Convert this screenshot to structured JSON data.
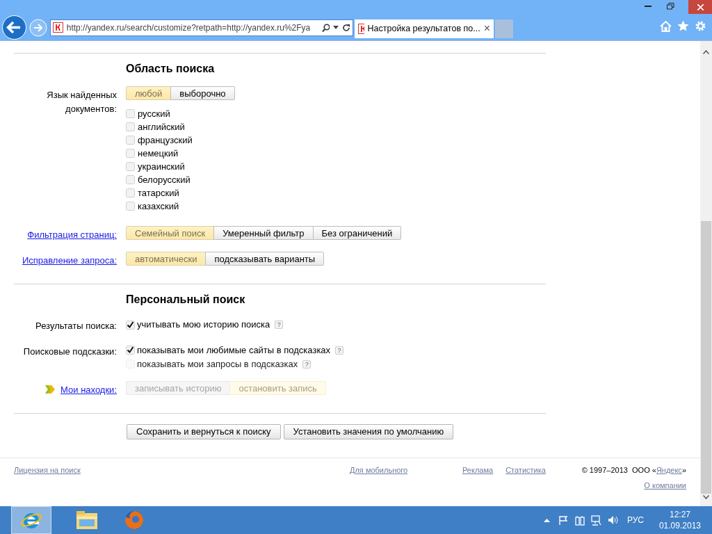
{
  "browser": {
    "url": "http://yandex.ru/search/customize?retpath=http://yandex.ru%2Fya",
    "tab_title": "Настройка результатов по...",
    "tab_close": "×"
  },
  "sections": [
    {
      "title": "Область поиска",
      "rows": [
        {
          "kind": "segmented",
          "label": "Язык найденных документов:",
          "label_link": false,
          "disabled": false,
          "has_icon": false,
          "options": [
            {
              "label": "любой",
              "selected": true
            },
            {
              "label": "выборочно",
              "selected": false
            }
          ],
          "checkboxes": [
            {
              "label": "русский",
              "checked": false
            },
            {
              "label": "английский",
              "checked": false
            },
            {
              "label": "французский",
              "checked": false
            },
            {
              "label": "немецкий",
              "checked": false
            },
            {
              "label": "украинский",
              "checked": false
            },
            {
              "label": "белорусский",
              "checked": false
            },
            {
              "label": "татарский",
              "checked": false
            },
            {
              "label": "казахский",
              "checked": false
            }
          ]
        },
        {
          "kind": "segmented",
          "label": "Фильтрация страниц:",
          "label_link": true,
          "disabled": false,
          "has_icon": false,
          "options": [
            {
              "label": "Семейный поиск",
              "selected": true
            },
            {
              "label": "Умеренный фильтр",
              "selected": false
            },
            {
              "label": "Без ограничений",
              "selected": false
            }
          ]
        },
        {
          "kind": "segmented",
          "label": "Исправление запроса:",
          "label_link": true,
          "disabled": false,
          "has_icon": false,
          "options": [
            {
              "label": "автоматически",
              "selected": true
            },
            {
              "label": "подсказывать варианты",
              "selected": false
            }
          ]
        }
      ]
    },
    {
      "title": "Персональный поиск",
      "rows": [
        {
          "kind": "checks",
          "label": "Результаты поиска:",
          "label_link": false,
          "items": [
            {
              "label": "учитывать мою историю поиска",
              "checked": true,
              "disabled": false,
              "help": "?"
            }
          ]
        },
        {
          "kind": "checks",
          "label": "Поисковые подсказки:",
          "label_link": false,
          "items": [
            {
              "label": "показывать мои любимые сайты в подсказках",
              "checked": true,
              "disabled": false,
              "help": "?"
            },
            {
              "label": "показывать мои запросы в подсказках",
              "checked": false,
              "disabled": true,
              "help": "?"
            }
          ]
        },
        {
          "kind": "segmented",
          "label": "Мои находки:",
          "label_link": true,
          "disabled": true,
          "has_icon": true,
          "options": [
            {
              "label": "записывать историю",
              "selected": false
            },
            {
              "label": "остановить запись",
              "selected": true
            }
          ]
        }
      ]
    }
  ],
  "actions": [
    "Сохранить и вернуться к поиску",
    "Установить значения по умолчанию"
  ],
  "footer": {
    "license": "Лицензия на поиск",
    "mobile": "Для мобильного",
    "ads": "Реклама",
    "stats": "Статистика",
    "copyright": "© 1997–2013  ООО «",
    "company": "Яндекс",
    "copyright_end": "»",
    "about": "О компании"
  },
  "taskbar": {
    "apps": [
      {
        "kind": "ie",
        "selected": true
      },
      {
        "kind": "explorer",
        "selected": false
      },
      {
        "kind": "firefox",
        "selected": false
      }
    ],
    "lang": "РУС",
    "time": "12:27",
    "date": "01.09.2013"
  }
}
